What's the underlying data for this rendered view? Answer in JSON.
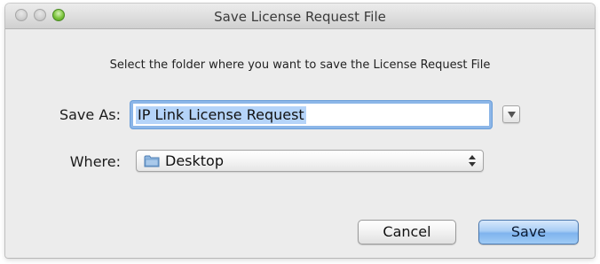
{
  "window": {
    "title": "Save License Request File"
  },
  "dialog": {
    "instruction": "Select the folder where you want to save the License Request File",
    "save_as_label": "Save As:",
    "save_as_value": "IP Link License Request",
    "where_label": "Where:",
    "where_value": "Desktop",
    "where_icon": "folder-icon",
    "expand_icon": "chevron-down-icon"
  },
  "buttons": {
    "cancel_label": "Cancel",
    "save_label": "Save"
  },
  "colors": {
    "focus_ring": "#6a9ed9",
    "selection": "#b5d4f9",
    "default_button": "#7fb3ee",
    "zoom_button": "#7cc43c"
  }
}
